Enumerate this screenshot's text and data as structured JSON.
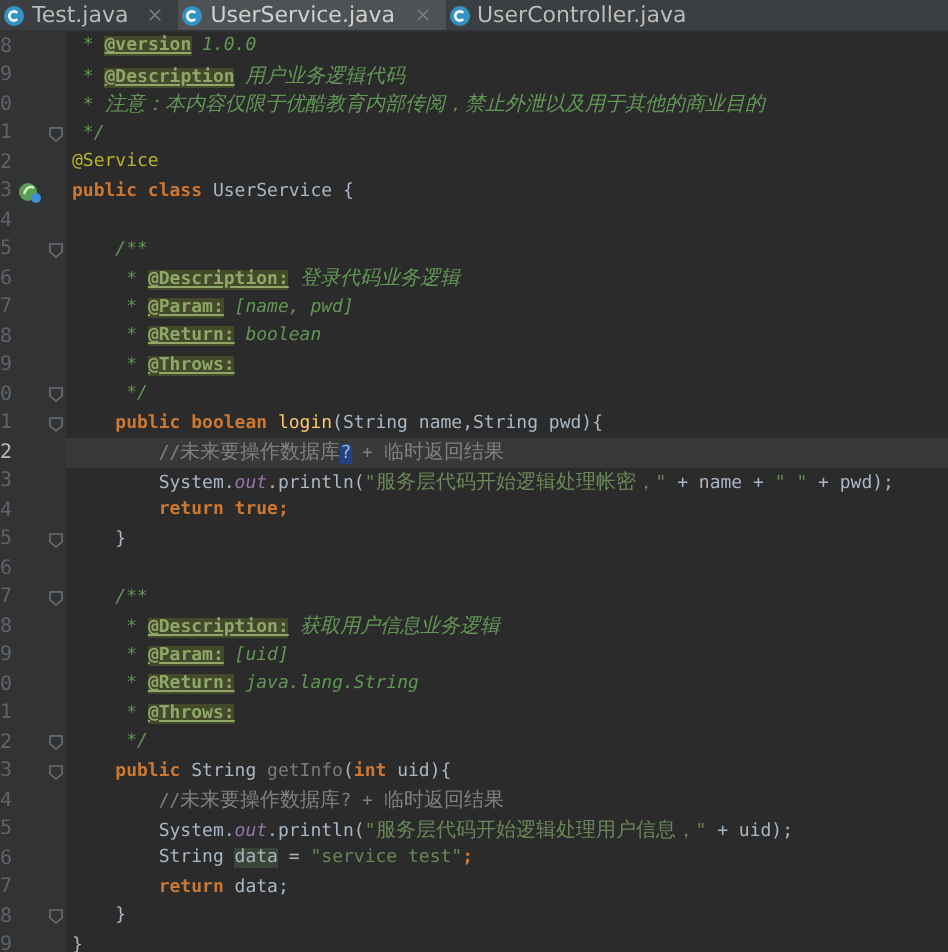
{
  "tabs": [
    {
      "label": "Test.java",
      "selected": false,
      "closable": true
    },
    {
      "label": "UserService.java",
      "selected": true,
      "closable": true
    },
    {
      "label": "UserController.java",
      "selected": false,
      "closable": false
    }
  ],
  "lines": [
    {
      "number": "8",
      "current": false,
      "tokens": [
        {
          "kind": "doc",
          "t": " * "
        },
        {
          "kind": "tag",
          "t": "@version"
        },
        {
          "kind": "doc",
          "t": " 1.0.0"
        }
      ]
    },
    {
      "number": "9",
      "current": false,
      "tokens": [
        {
          "kind": "doc",
          "t": " * "
        },
        {
          "kind": "tag",
          "t": "@Description"
        },
        {
          "kind": "doc",
          "t": " 用户业务逻辑代码"
        }
      ]
    },
    {
      "number": "0",
      "current": false,
      "tokens": [
        {
          "kind": "doc",
          "t": " * 注意：本内容仅限于优酷教育内部传阅，禁止外泄以及用于其他的商业目的"
        }
      ]
    },
    {
      "number": "1",
      "gutter": {
        "kind": "fold"
      },
      "current": false,
      "tokens": [
        {
          "kind": "doc",
          "t": " */"
        }
      ]
    },
    {
      "number": "2",
      "current": false,
      "tokens": [
        {
          "kind": "ann",
          "t": "@Service"
        }
      ]
    },
    {
      "number": "3",
      "gutter": {
        "kind": "bean"
      },
      "current": false,
      "tokens": [
        {
          "kind": "kw",
          "t": "public class "
        },
        {
          "kind": "plain",
          "t": "UserService {"
        }
      ]
    },
    {
      "number": "4",
      "current": false
    },
    {
      "number": "5",
      "gutter": {
        "kind": "fold"
      },
      "current": false,
      "tokens": [
        {
          "kind": "doc",
          "t": "    /**"
        }
      ]
    },
    {
      "number": "6",
      "current": false,
      "tokens": [
        {
          "kind": "doc",
          "t": "     * "
        },
        {
          "kind": "tag",
          "t": "@Description:"
        },
        {
          "kind": "doc",
          "t": " 登录代码业务逻辑"
        }
      ]
    },
    {
      "number": "7",
      "current": false,
      "tokens": [
        {
          "kind": "doc",
          "t": "     * "
        },
        {
          "kind": "tag",
          "t": "@Param:"
        },
        {
          "kind": "doc",
          "t": " [name, pwd]"
        }
      ]
    },
    {
      "number": "8",
      "current": false,
      "tokens": [
        {
          "kind": "doc",
          "t": "     * "
        },
        {
          "kind": "tag",
          "t": "@Return:"
        },
        {
          "kind": "doc",
          "t": " boolean"
        }
      ]
    },
    {
      "number": "9",
      "current": false,
      "tokens": [
        {
          "kind": "doc",
          "t": "     * "
        },
        {
          "kind": "tag",
          "t": "@Throws:"
        }
      ]
    },
    {
      "number": "0",
      "gutter": {
        "kind": "fold"
      },
      "current": false,
      "tokens": [
        {
          "kind": "doc",
          "t": "     */"
        }
      ]
    },
    {
      "number": "1",
      "gutter": {
        "kind": "fold"
      },
      "current": false,
      "tokens": [
        {
          "kind": "kw",
          "t": "    public boolean "
        },
        {
          "kind": "fn",
          "t": "login"
        },
        {
          "kind": "plain",
          "t": "(String name,String pwd){"
        }
      ]
    },
    {
      "number": "2",
      "current": true,
      "tokens": [
        {
          "kind": "cmt",
          "t": "        //未来要操作数据库"
        },
        {
          "kind": "sel",
          "t": "?"
        },
        {
          "kind": "cmt",
          "t": " + 临时返回结果"
        }
      ]
    },
    {
      "number": "3",
      "current": false,
      "tokens": [
        {
          "kind": "plain",
          "t": "        System."
        },
        {
          "kind": "fld",
          "t": "out"
        },
        {
          "kind": "plain",
          "t": ".println("
        },
        {
          "kind": "str",
          "t": "\"服务层代码开始逻辑处理帐密，\""
        },
        {
          "kind": "plain",
          "t": " + name + "
        },
        {
          "kind": "str",
          "t": "\" \""
        },
        {
          "kind": "plain",
          "t": " + pwd);"
        }
      ]
    },
    {
      "number": "4",
      "current": false,
      "tokens": [
        {
          "kind": "kw",
          "t": "        return true;"
        }
      ]
    },
    {
      "number": "5",
      "gutter": {
        "kind": "fold"
      },
      "current": false,
      "tokens": [
        {
          "kind": "plain",
          "t": "    }"
        }
      ]
    },
    {
      "number": "6",
      "current": false
    },
    {
      "number": "7",
      "gutter": {
        "kind": "fold"
      },
      "current": false,
      "tokens": [
        {
          "kind": "doc",
          "t": "    /**"
        }
      ]
    },
    {
      "number": "8",
      "current": false,
      "tokens": [
        {
          "kind": "doc",
          "t": "     * "
        },
        {
          "kind": "tag",
          "t": "@Description:"
        },
        {
          "kind": "doc",
          "t": " 获取用户信息业务逻辑"
        }
      ]
    },
    {
      "number": "9",
      "current": false,
      "tokens": [
        {
          "kind": "doc",
          "t": "     * "
        },
        {
          "kind": "tag",
          "t": "@Param:"
        },
        {
          "kind": "doc",
          "t": " [uid]"
        }
      ]
    },
    {
      "number": "0",
      "current": false,
      "tokens": [
        {
          "kind": "doc",
          "t": "     * "
        },
        {
          "kind": "tag",
          "t": "@Return:"
        },
        {
          "kind": "doc",
          "t": " java.lang.String"
        }
      ]
    },
    {
      "number": "1",
      "current": false,
      "tokens": [
        {
          "kind": "doc",
          "t": "     * "
        },
        {
          "kind": "tag",
          "t": "@Throws:"
        }
      ]
    },
    {
      "number": "2",
      "gutter": {
        "kind": "fold"
      },
      "current": false,
      "tokens": [
        {
          "kind": "doc",
          "t": "     */"
        }
      ]
    },
    {
      "number": "3",
      "gutter": {
        "kind": "fold"
      },
      "current": false,
      "tokens": [
        {
          "kind": "kw",
          "t": "    public "
        },
        {
          "kind": "plain",
          "t": "String "
        },
        {
          "kind": "unused",
          "t": "getInfo"
        },
        {
          "kind": "plain",
          "t": "("
        },
        {
          "kind": "kw",
          "t": "int "
        },
        {
          "kind": "plain",
          "t": "uid){"
        }
      ]
    },
    {
      "number": "4",
      "current": false,
      "tokens": [
        {
          "kind": "cmt",
          "t": "        //未来要操作数据库? + 临时返回结果"
        }
      ]
    },
    {
      "number": "5",
      "current": false,
      "tokens": [
        {
          "kind": "plain",
          "t": "        System."
        },
        {
          "kind": "fld",
          "t": "out"
        },
        {
          "kind": "plain",
          "t": ".println("
        },
        {
          "kind": "str",
          "t": "\"服务层代码开始逻辑处理用户信息，\""
        },
        {
          "kind": "plain",
          "t": " + uid);"
        }
      ]
    },
    {
      "number": "6",
      "current": false,
      "tokens": [
        {
          "kind": "plain",
          "t": "        String "
        },
        {
          "kind": "hl",
          "t": "data"
        },
        {
          "kind": "plain",
          "t": " = "
        },
        {
          "kind": "str",
          "t": "\"service test\""
        },
        {
          "kind": "kw",
          "t": ";"
        }
      ]
    },
    {
      "number": "7",
      "current": false,
      "tokens": [
        {
          "kind": "kw",
          "t": "        return "
        },
        {
          "kind": "plain",
          "t": "data;"
        }
      ]
    },
    {
      "number": "8",
      "gutter": {
        "kind": "fold"
      },
      "current": false,
      "tokens": [
        {
          "kind": "plain",
          "t": "    }"
        }
      ]
    },
    {
      "number": "9",
      "current": false,
      "tokens": [
        {
          "kind": "plain",
          "t": "}"
        }
      ]
    }
  ]
}
